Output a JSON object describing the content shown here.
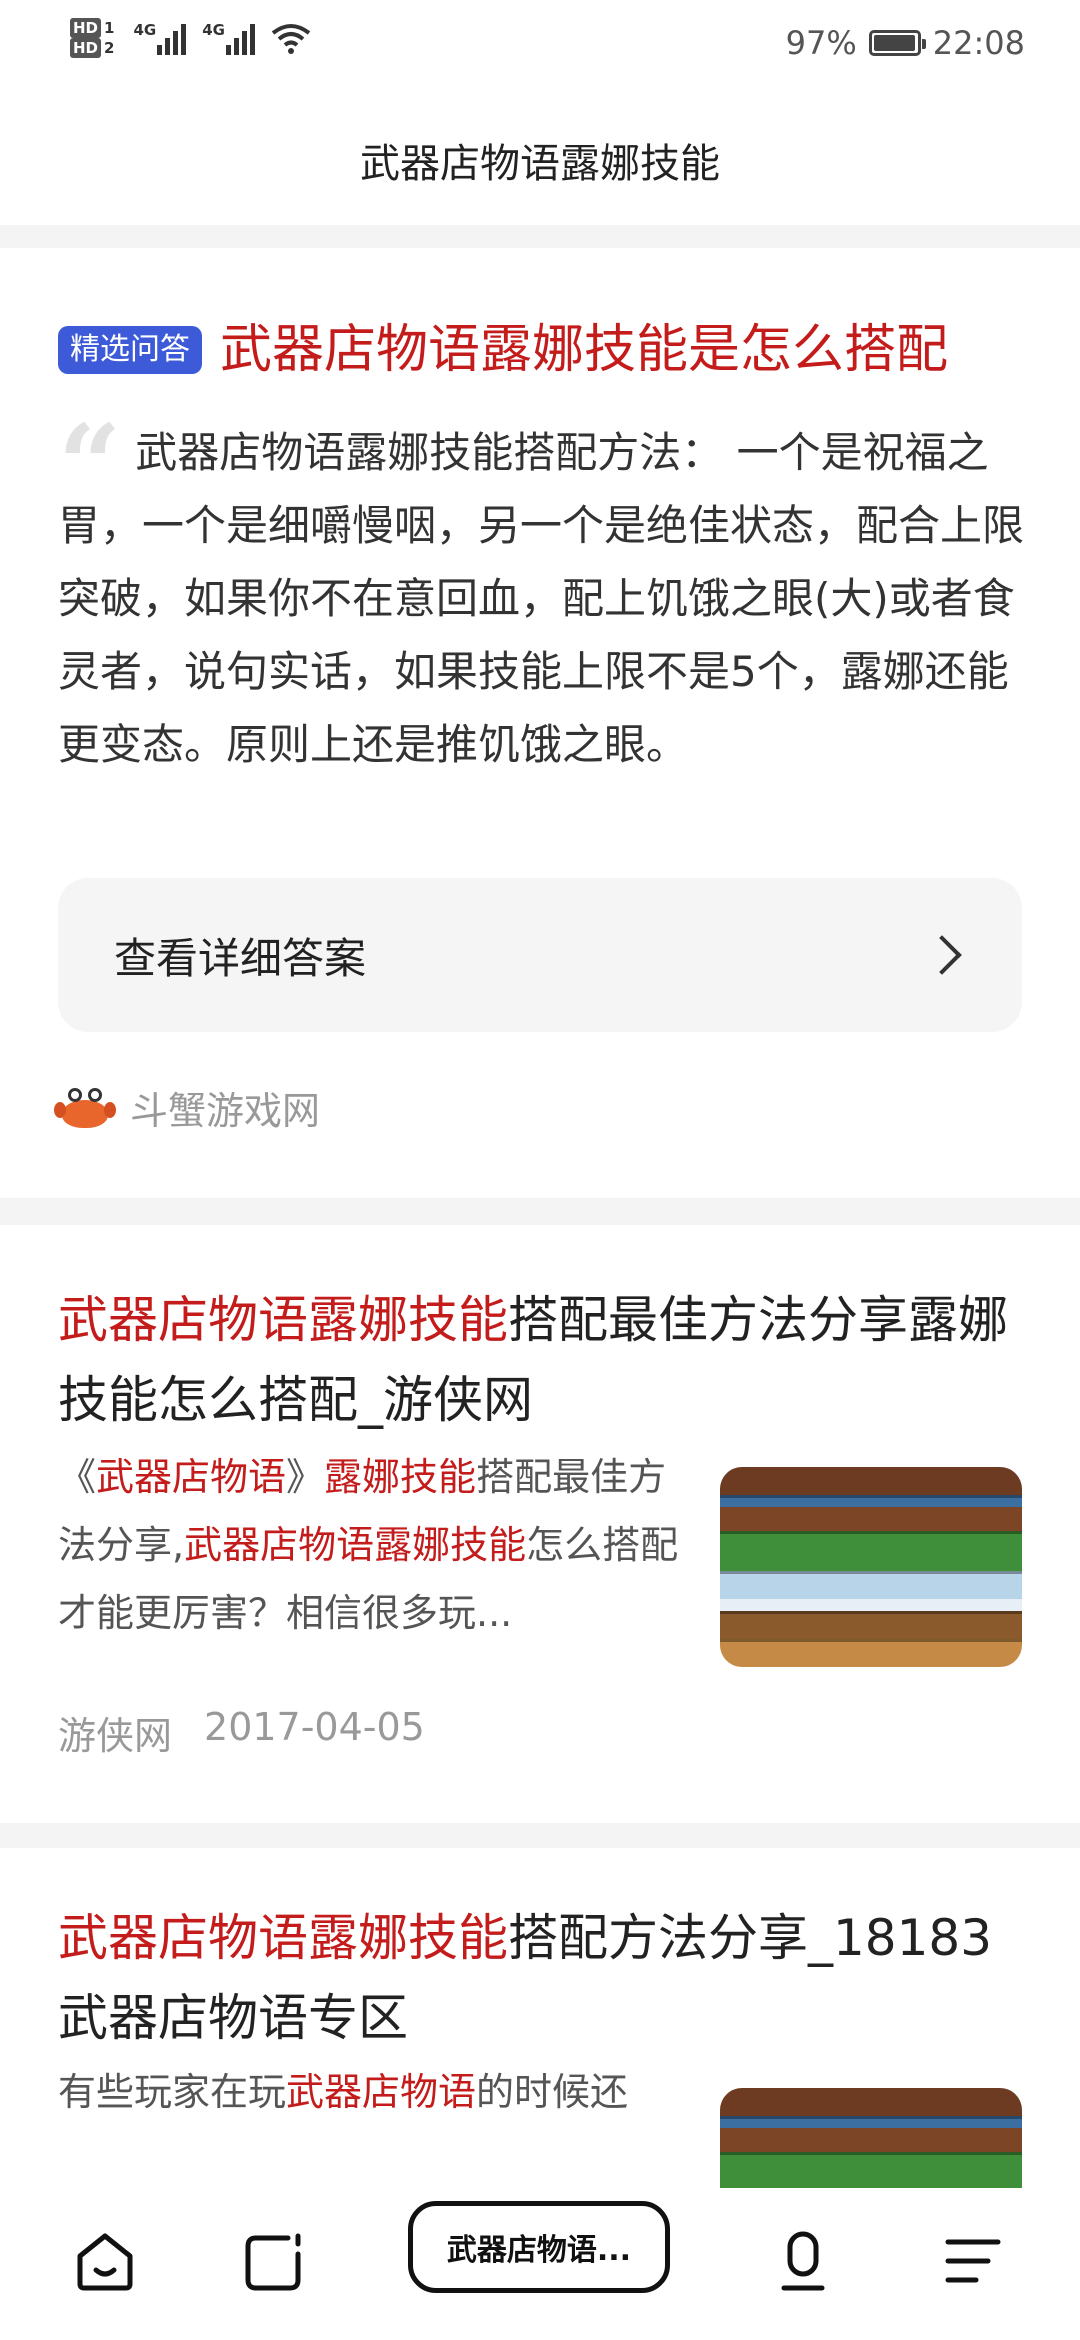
{
  "status_bar": {
    "hd1": "HD",
    "hd1_sub": "1",
    "hd2": "HD",
    "hd2_sub": "2",
    "sig1": "4G",
    "sig2": "4G",
    "battery": "97%",
    "battery_level": 0.97,
    "time": "22:08"
  },
  "header": {
    "title": "武器店物语露娜技能"
  },
  "featured_answer": {
    "badge": "精选问答",
    "title": "武器店物语露娜技能是怎么搭配",
    "body": "武器店物语露娜技能搭配方法： 一个是祝福之胃，一个是细嚼慢咽，另一个是绝佳状态，配合上限突破，如果你不在意回血，配上饥饿之眼(大)或者食灵者，说句实话，如果技能上限不是5个，露娜还能更变态。原则上还是推饥饿之眼。",
    "detail_button": "查看详细答案",
    "source": "斗蟹游戏网"
  },
  "results": [
    {
      "title_highlight": "武器店物语露娜技能",
      "title_rest": "搭配最佳方法分享露娜技能怎么搭配_游侠网",
      "snippet_parts": [
        {
          "text": "《",
          "hl": false
        },
        {
          "text": "武器店物语",
          "hl": true
        },
        {
          "text": "》",
          "hl": false
        },
        {
          "text": "露娜技能",
          "hl": true
        },
        {
          "text": "搭配最佳方法分享,",
          "hl": false
        },
        {
          "text": "武器店物语露娜技能",
          "hl": true
        },
        {
          "text": "怎么搭配才能更厉害？相信很多玩...",
          "hl": false
        }
      ],
      "source": "游侠网",
      "date": "2017-04-05"
    },
    {
      "title_highlight": "武器店物语露娜技能",
      "title_rest": "搭配方法分享_18183武器店物语专区",
      "snippet_parts": [
        {
          "text": "有些玩家在玩",
          "hl": false
        },
        {
          "text": "武器店物语",
          "hl": true
        },
        {
          "text": "的时候还",
          "hl": false
        }
      ]
    }
  ],
  "bottom_nav": {
    "search_text": "武器店物语...",
    "icons": [
      "home-icon",
      "tabs-icon",
      "microphone-icon",
      "menu-icon"
    ]
  }
}
